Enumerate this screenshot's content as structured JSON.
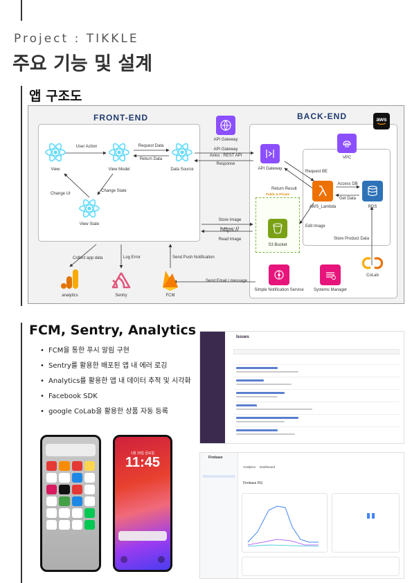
{
  "header": {
    "project": "Project : TIKKLE",
    "title": "주요 기능 및 설계"
  },
  "sections": {
    "architecture": "앱 구조도",
    "features": "FCM, Sentry, Analytics"
  },
  "diagram": {
    "front_end": "FRONT-END",
    "back_end": "BACK-END",
    "aws_logo": "aws",
    "nodes": {
      "view": "View",
      "view_model": "View Model",
      "data_source": "Data Source",
      "view_state": "View State",
      "api_gateway_top": "API Gateway",
      "api_gateway": "API Gateway",
      "vpc": "VPC",
      "lambda": "AWS_Lambda",
      "rds": "RDS",
      "s3": "S3 Bucket",
      "public_private": "Public & Private",
      "sns": "Simple Notification Service",
      "systems_manager": "Systems Manager",
      "colab": "CoLab",
      "analytics": "analytics",
      "sentry": "Sentry",
      "fcm": "FCM"
    },
    "edges": {
      "user_action": "User Action",
      "request_data": "Request Data",
      "return_data": "Return Data",
      "change_ui": "Change UI",
      "change_state": "Change State",
      "axios": "Axios : REST API",
      "api_gateway_edge": "API Gateway",
      "response": "Response",
      "request_be": "Request BE",
      "return_result": "Return Result",
      "access_db": "Access DB",
      "get_data": "Get Data",
      "edit_image": "Edit Image",
      "store_product_data": "Store Product Data",
      "store_image": "Store Image",
      "https": "https://",
      "read_image": "Read Image",
      "collect_app_data": "Collect app data",
      "log_error": "Log Error",
      "send_push": "Send Push Notification",
      "send_email": "Send Email / message"
    }
  },
  "bullets": [
    "FCM을 통한 푸시 알림 구현",
    "Sentry를 활용한 배포된 앱 내 에러 로깅",
    "Analytics를 활용한 앱 내 데이터 추적 및 시각화",
    "Facebook SDK",
    "google CoLab을 활용한 상품 자동 등록"
  ],
  "phone2": {
    "date": "1월 19일 금요일",
    "time": "11:45"
  },
  "sentry_shot": {
    "title": "Issues"
  },
  "firebase_shot": {
    "brand": "Firebase",
    "product": "Analytics",
    "tab": "Dashboard",
    "project": "Firebase RG"
  },
  "colors": {
    "react": "#61dafb",
    "aws_purple": "#8c4fff",
    "aws_orange": "#ed7100",
    "aws_blue": "#2e73b8",
    "aws_pink": "#e7157b",
    "s3_green": "#7aa116",
    "title_navy": "#1e3a6e"
  }
}
